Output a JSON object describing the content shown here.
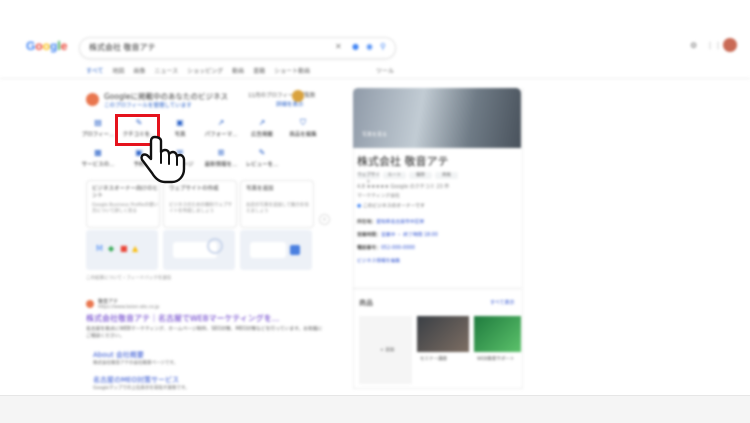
{
  "header": {
    "logo": "Google",
    "logo_colors": [
      "#4285f4",
      "#ea4335",
      "#fbbc05",
      "#4285f4",
      "#34a853",
      "#ea4335"
    ],
    "search_query": "株式会社 敬音アテ"
  },
  "tabs": {
    "items": [
      "すべて",
      "地図",
      "画像",
      "ニュース",
      "ショッピング",
      "動画",
      "書籍",
      "ショート動画"
    ],
    "active_index": 0,
    "tools": "ツール"
  },
  "business_profile": {
    "title": "Googleに掲載中のあなたのビジネス",
    "subtitle": "このプロフィールを管理しています",
    "views": "11月のプロフィール閲覧数",
    "manage": "詳細を表示",
    "actions_row1": [
      "プロフィー...",
      "クチコミを...",
      "写真",
      "パフォーマ...",
      "広告掲載",
      "商品を編集"
    ],
    "actions_row2": [
      "サービスの...",
      "予約",
      "メッセージ",
      "最新情報を...",
      "レビューを..."
    ]
  },
  "cards": [
    {
      "title": "ビジネスオーナー向けのヒント",
      "desc": "Google Business Profileの使い方について詳しく見る"
    },
    {
      "title": "ウェブサイトの作成",
      "desc": "ビジネスのための無料ウェブサイトを作成しましょう"
    },
    {
      "title": "写真を追加",
      "desc": "お店の写真を追加して魅力を伝えましょう"
    }
  ],
  "feedback": "この結果について・フィードバックを送信",
  "result": {
    "site": "敬音アテ",
    "url": "https://www.keion-ate.co.jp",
    "title": "株式会社敬音アテ｜名古屋でWEBマーケティングを...",
    "desc": "名古屋を拠点にWEBマーケティング、ホームページ制作、SEO対策、MEO対策などを行っています。お気軽にご相談ください。",
    "sublinks": [
      {
        "title": "About 会社概要",
        "desc": "株式会社敬音アテの会社概要ページです。"
      },
      {
        "title": "名古屋のMEO対策サービス",
        "desc": "Googleマップでの上位表示を目指す施策です。"
      }
    ]
  },
  "knowledge_panel": {
    "photos_label": "写真を見る",
    "title": "株式会社 敬音アテ",
    "chips": [
      "ウェブサイト",
      "ルート",
      "保存",
      "共有"
    ],
    "rating": "4.8 ★★★★★ Google のクチコミ 23 件",
    "type": "マーケティング会社",
    "badge": "このビジネスのオーナーです",
    "lines": [
      {
        "label": "所在地：",
        "value": "愛知県名古屋市中区栄"
      },
      {
        "label": "営業時間：",
        "value": "営業中 ・ 終了時間 18:00"
      },
      {
        "label": "電話番号：",
        "value": "052-000-0000"
      },
      {
        "label": "",
        "value": "ビジネス情報を編集"
      }
    ],
    "goods": "商品",
    "goods_more": "すべて表示",
    "goods_add": "追加",
    "goods_items": [
      "セミナー講座",
      "WEB集客サポート"
    ]
  }
}
